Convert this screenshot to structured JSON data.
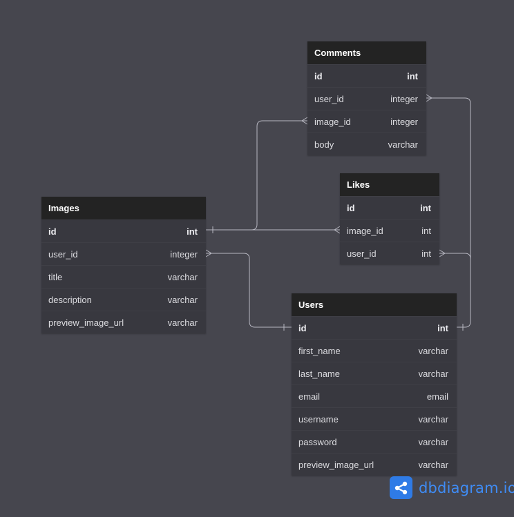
{
  "tables": {
    "comments": {
      "name": "Comments",
      "columns": [
        {
          "name": "id",
          "type": "int",
          "pk": true
        },
        {
          "name": "user_id",
          "type": "integer"
        },
        {
          "name": "image_id",
          "type": "integer"
        },
        {
          "name": "body",
          "type": "varchar"
        }
      ]
    },
    "likes": {
      "name": "Likes",
      "columns": [
        {
          "name": "id",
          "type": "int",
          "pk": true
        },
        {
          "name": "image_id",
          "type": "int"
        },
        {
          "name": "user_id",
          "type": "int"
        }
      ]
    },
    "images": {
      "name": "Images",
      "columns": [
        {
          "name": "id",
          "type": "int",
          "pk": true
        },
        {
          "name": "user_id",
          "type": "integer"
        },
        {
          "name": "title",
          "type": "varchar"
        },
        {
          "name": "description",
          "type": "varchar"
        },
        {
          "name": "preview_image_url",
          "type": "varchar"
        }
      ]
    },
    "users": {
      "name": "Users",
      "columns": [
        {
          "name": "id",
          "type": "int",
          "pk": true
        },
        {
          "name": "first_name",
          "type": "varchar"
        },
        {
          "name": "last_name",
          "type": "varchar"
        },
        {
          "name": "email",
          "type": "email"
        },
        {
          "name": "username",
          "type": "varchar"
        },
        {
          "name": "password",
          "type": "varchar"
        },
        {
          "name": "preview_image_url",
          "type": "varchar"
        }
      ]
    }
  },
  "relations": [
    {
      "from": "images.id",
      "to": "comments.image_id",
      "type": "one-to-many"
    },
    {
      "from": "images.id",
      "to": "likes.image_id",
      "type": "one-to-many"
    },
    {
      "from": "users.id",
      "to": "images.user_id",
      "type": "one-to-many"
    },
    {
      "from": "users.id",
      "to": "comments.user_id",
      "type": "one-to-many"
    },
    {
      "from": "users.id",
      "to": "likes.user_id",
      "type": "one-to-many"
    }
  ],
  "brand": {
    "text": "dbdiagram.io",
    "logo_icon": "share-nodes-icon",
    "color": "#3f8cf5"
  },
  "colors": {
    "background": "#46464e",
    "header": "#232323",
    "body": "#38383f",
    "connector": "#b8b8c2",
    "accent": "#2f7be6"
  }
}
